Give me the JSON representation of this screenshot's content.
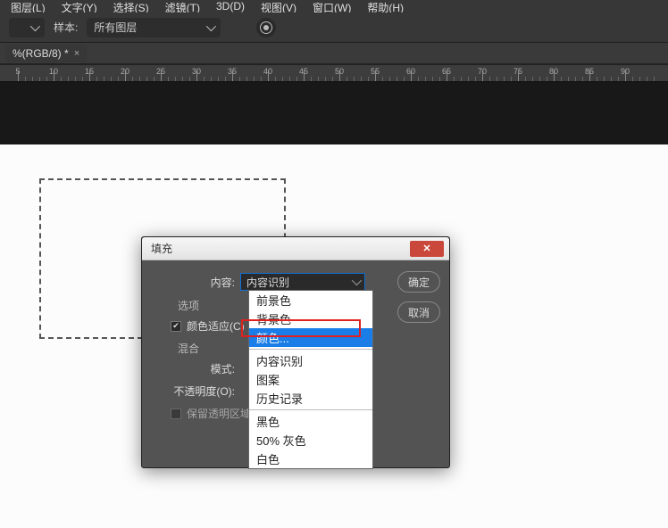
{
  "menu": [
    "图层(L)",
    "文字(Y)",
    "选择(S)",
    "滤镜(T)",
    "3D(D)",
    "视图(V)",
    "窗口(W)",
    "帮助(H)"
  ],
  "options": {
    "sample_label": "样本:",
    "sample_value": "所有图层"
  },
  "tab": {
    "title": "%(RGB/8) *"
  },
  "ruler_marks": [
    5,
    10,
    15,
    20,
    25,
    30,
    35,
    40,
    45,
    50,
    55,
    60,
    65,
    70,
    75,
    80,
    85,
    90
  ],
  "dialog": {
    "title": "填充",
    "content_label": "内容:",
    "content_value": "内容识别",
    "options_label": "选项",
    "color_adapt_label": "颜色适应(C)",
    "blend_label": "混合",
    "mode_label": "模式:",
    "opacity_label": "不透明度(O):",
    "preserve_label": "保留透明区域",
    "ok": "确定",
    "cancel": "取消"
  },
  "dropdown": {
    "items": [
      "前景色",
      "背景色",
      "颜色...",
      "",
      "内容识别",
      "图案",
      "历史记录",
      "",
      "黑色",
      "50% 灰色",
      "白色"
    ],
    "selected_index": 2
  }
}
